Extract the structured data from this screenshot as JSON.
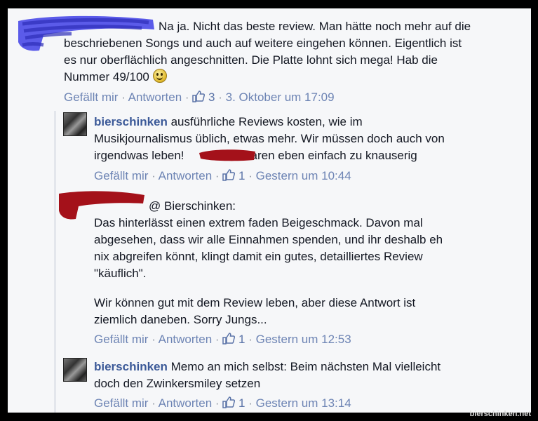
{
  "comment1": {
    "text_line1": "Na ja. Nicht das beste review. Man hätte noch mehr auf die",
    "text_line2": "beschriebenen Songs und auch auf weitere eingehen können. Eigentlich ist",
    "text_line3": "es nur oberflächlich angeschnitten. Die Platte lohnt sich mega! Hab die",
    "text_line4": "Nummer 49/100",
    "like_label": "Gefällt mir",
    "reply_label": "Antworten",
    "likes": "3",
    "timestamp": "3. Oktober um 17:09"
  },
  "reply1": {
    "author": "bierschinken",
    "text_line1": " ausführliche Reviews kosten, wie im",
    "text_line2": "Musikjournalismus üblich, etwas mehr. Wir müssen doch auch von",
    "text_line3a": "irgendwas leben! ",
    "text_line3b": "waren eben einfach zu knauserig",
    "like_label": "Gefällt mir",
    "reply_label": "Antworten",
    "likes": "1",
    "timestamp": "Gestern um 10:44"
  },
  "reply2": {
    "mention": "@ Bierschinken:",
    "para1_line1": "Das hinterlässt einen extrem faden Beigeschmack. Davon mal",
    "para1_line2": "abgesehen, dass wir alle Einnahmen spenden, und ihr deshalb eh",
    "para1_line3": "nix abgreifen könnt, klingt damit ein gutes, detailliertes Review",
    "para1_line4": "\"käuflich\".",
    "para2_line1": "Wir können gut mit dem Review leben, aber diese Antwort ist",
    "para2_line2": "ziemlich daneben. Sorry Jungs...",
    "like_label": "Gefällt mir",
    "reply_label": "Antworten",
    "likes": "1",
    "timestamp": "Gestern um 12:53"
  },
  "reply3": {
    "author": "bierschinken",
    "text_line1": " Memo an mich selbst: Beim nächsten Mal vielleicht",
    "text_line2": "doch den Zwinkersmiley setzen",
    "like_label": "Gefällt mir",
    "reply_label": "Antworten",
    "likes": "1",
    "timestamp": "Gestern um 13:14"
  },
  "separator": " · ",
  "watermark": "bierschinken.net",
  "colors": {
    "link": "#6d84b4",
    "author": "#3b5998",
    "meta": "#9197a3",
    "redact_blue": "#3f3fe6",
    "redact_red": "#a4111a"
  }
}
